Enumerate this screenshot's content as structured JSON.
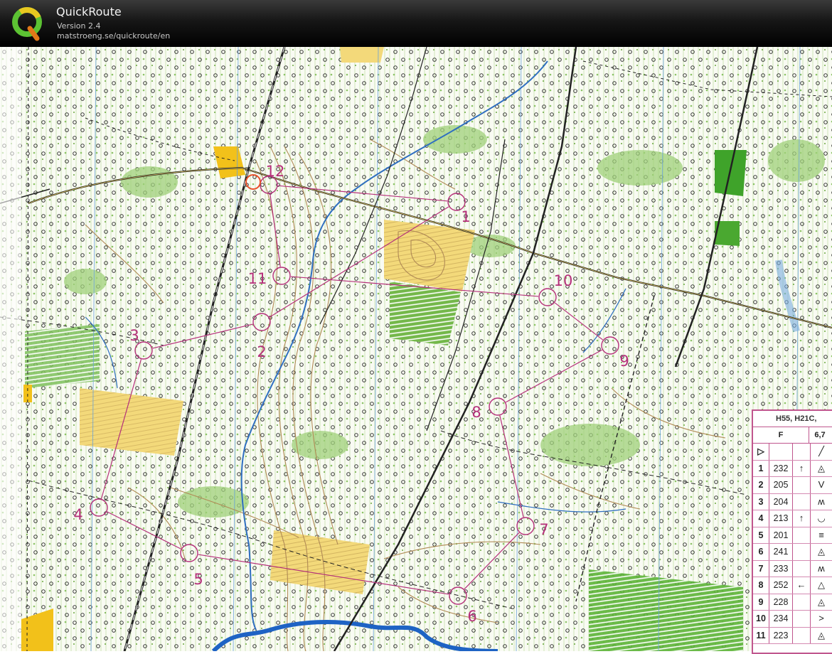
{
  "app": {
    "title": "QuickRoute",
    "version": "Version 2.4",
    "url": "matstroeng.se/quickroute/en"
  },
  "colors": {
    "course": "#b5307a",
    "contour": "#b08a55",
    "water": "#2f6fc0",
    "open_yellow": "#f3d97a",
    "green": "#74b84a",
    "black": "#111111",
    "header": "#111111"
  },
  "map": {
    "type": "orienteering-map",
    "controls": [
      {
        "label": "1"
      },
      {
        "label": "2"
      },
      {
        "label": "3"
      },
      {
        "label": "4"
      },
      {
        "label": "5"
      },
      {
        "label": "6"
      },
      {
        "label": "7"
      },
      {
        "label": "8"
      },
      {
        "label": "9"
      },
      {
        "label": "10"
      },
      {
        "label": "11"
      },
      {
        "label": "12"
      }
    ]
  },
  "control_card": {
    "title": "H55, H21C,",
    "course_letter": "F",
    "distance": "6,7",
    "rows": [
      {
        "num": "1",
        "code": "232",
        "col_d": "↑",
        "col_e": "◬"
      },
      {
        "num": "2",
        "code": "205",
        "col_d": "",
        "col_e": "V"
      },
      {
        "num": "3",
        "code": "204",
        "col_d": "",
        "col_e": "ʍ"
      },
      {
        "num": "4",
        "code": "213",
        "col_d": "↑",
        "col_e": "◡"
      },
      {
        "num": "5",
        "code": "201",
        "col_d": "",
        "col_e": "≡"
      },
      {
        "num": "6",
        "code": "241",
        "col_d": "",
        "col_e": "◬"
      },
      {
        "num": "7",
        "code": "233",
        "col_d": "",
        "col_e": "ʍ"
      },
      {
        "num": "8",
        "code": "252",
        "col_d": "←",
        "col_e": "△"
      },
      {
        "num": "9",
        "code": "228",
        "col_d": "",
        "col_e": "◬"
      },
      {
        "num": "10",
        "code": "234",
        "col_d": "",
        "col_e": ">"
      },
      {
        "num": "11",
        "code": "223",
        "col_d": "",
        "col_e": "◬"
      }
    ]
  }
}
